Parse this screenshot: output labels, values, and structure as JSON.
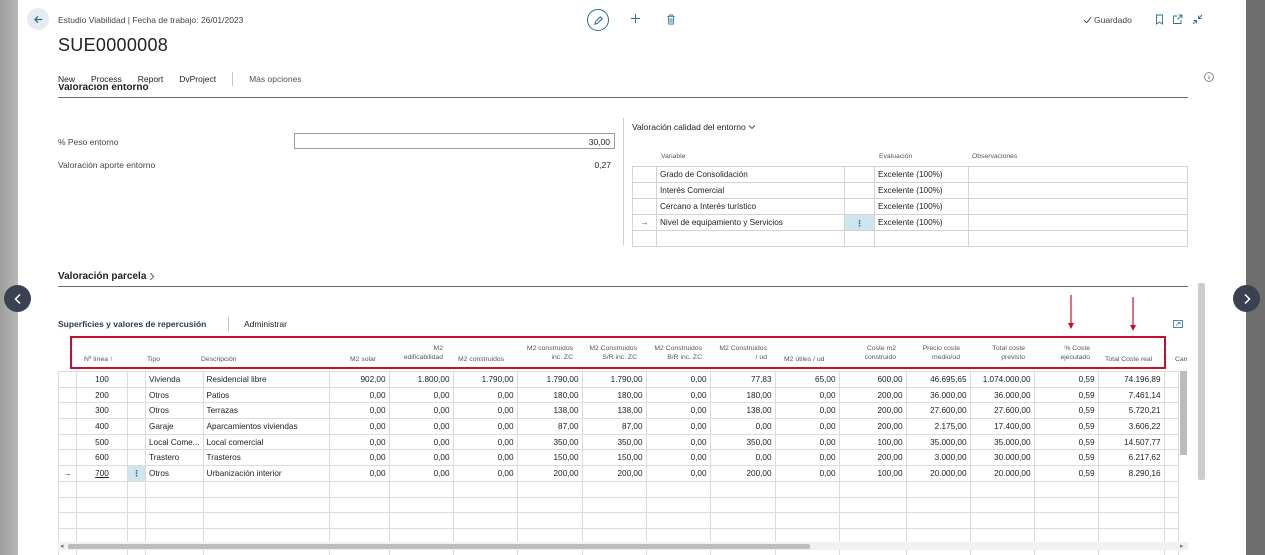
{
  "header": {
    "breadcrumb": "Estudio Viabilidad | Fecha de trabajo: 26/01/2023",
    "record_no": "SUE0000008",
    "saved_label": "Guardado"
  },
  "actions": {
    "new": "New",
    "process": "Process",
    "report": "Report",
    "dvproject": "DvProject",
    "more": "Más opciones"
  },
  "entorno": {
    "section_title": "Valoración entorno",
    "peso_label": "% Peso entorno",
    "peso_value": "30,00",
    "aporte_label": "Valoración aporte entorno",
    "aporte_value": "0,27",
    "calidad_title": "Valoración calidad del entorno",
    "columns": {
      "variable": "Variable",
      "evaluacion": "Evaluación",
      "observaciones": "Observaciones"
    },
    "rows": [
      {
        "variable": "Grado de Consolidación",
        "evaluacion": "Excelente (100%)",
        "observaciones": ""
      },
      {
        "variable": "Interés Comercial",
        "evaluacion": "Excelente (100%)",
        "observaciones": ""
      },
      {
        "variable": "Cercano a Interés turístico",
        "evaluacion": "Excelente (100%)",
        "observaciones": ""
      },
      {
        "variable": "Nivel de equipamiento y Servicios",
        "evaluacion": "Excelente (100%)",
        "observaciones": ""
      }
    ],
    "current_row_marker": "→",
    "dots": "⋮"
  },
  "parcela": {
    "section_title": "Valoración parcela"
  },
  "superficies": {
    "title": "Superficies y valores de repercusión",
    "admin": "Administrar",
    "columns": {
      "linea": "Nº línea ↑",
      "tipo": "Tipo",
      "descripcion": "Descripción",
      "m2_solar": "M2 solar",
      "m2_edif_1": "M2",
      "m2_edif_2": "edificabilidad",
      "m2_const": "M2 construidos",
      "m2_zc_1": "M2 construidos",
      "m2_zc_2": "inc. ZC",
      "m2_sr_1": "M2 Construidos",
      "m2_sr_2": "S/R inc. ZC",
      "m2_br_1": "M2 Construidos",
      "m2_br_2": "B/R inc. ZC",
      "m2_ud_1": "M2 Construidos",
      "m2_ud_2": "/ ud",
      "m2_utiles": "M2 útiles / ud",
      "coste_m2_1": "Coste m2",
      "coste_m2_2": "construido",
      "precio_1": "Precio coste",
      "precio_2": "medio/ud",
      "total_prev_1": "Total coste",
      "total_prev_2": "previsto",
      "pct_1": "% Coste",
      "pct_2": "ejecutado",
      "total_real": "Total Coste real",
      "cut": "Can"
    },
    "rows": [
      {
        "linea": "100",
        "tipo": "Vivienda",
        "desc": "Residencial libre",
        "solar": "902,00",
        "edif": "1.800,00",
        "const": "1.790,00",
        "zc": "1.790,00",
        "sr": "1.790,00",
        "br": "0,00",
        "ud": "77,83",
        "utiles": "65,00",
        "coste": "600,00",
        "precio": "46.695,65",
        "prev": "1.074.000,00",
        "pct": "0,59",
        "real": "74.196,89"
      },
      {
        "linea": "200",
        "tipo": "Otros",
        "desc": "Patios",
        "solar": "0,00",
        "edif": "0,00",
        "const": "0,00",
        "zc": "180,00",
        "sr": "180,00",
        "br": "0,00",
        "ud": "180,00",
        "utiles": "0,00",
        "coste": "200,00",
        "precio": "36.000,00",
        "prev": "36.000,00",
        "pct": "0,59",
        "real": "7.461,14"
      },
      {
        "linea": "300",
        "tipo": "Otros",
        "desc": "Terrazas",
        "solar": "0,00",
        "edif": "0,00",
        "const": "0,00",
        "zc": "138,00",
        "sr": "138,00",
        "br": "0,00",
        "ud": "138,00",
        "utiles": "0,00",
        "coste": "200,00",
        "precio": "27.600,00",
        "prev": "27.600,00",
        "pct": "0,59",
        "real": "5.720,21"
      },
      {
        "linea": "400",
        "tipo": "Garaje",
        "desc": "Aparcamientos viviendas",
        "solar": "0,00",
        "edif": "0,00",
        "const": "0,00",
        "zc": "87,00",
        "sr": "87,00",
        "br": "0,00",
        "ud": "0,00",
        "utiles": "0,00",
        "coste": "200,00",
        "precio": "2.175,00",
        "prev": "17.400,00",
        "pct": "0,59",
        "real": "3.606,22"
      },
      {
        "linea": "500",
        "tipo": "Local Come...",
        "desc": "Local comercial",
        "solar": "0,00",
        "edif": "0,00",
        "const": "0,00",
        "zc": "350,00",
        "sr": "350,00",
        "br": "0,00",
        "ud": "350,00",
        "utiles": "0,00",
        "coste": "100,00",
        "precio": "35.000,00",
        "prev": "35.000,00",
        "pct": "0,59",
        "real": "14.507,77"
      },
      {
        "linea": "600",
        "tipo": "Trastero",
        "desc": "Trasteros",
        "solar": "0,00",
        "edif": "0,00",
        "const": "0,00",
        "zc": "150,00",
        "sr": "150,00",
        "br": "0,00",
        "ud": "0,00",
        "utiles": "0,00",
        "coste": "200,00",
        "precio": "3.000,00",
        "prev": "30.000,00",
        "pct": "0,59",
        "real": "6.217,62"
      },
      {
        "linea": "700",
        "tipo": "Otros",
        "desc": "Urbanización interior",
        "solar": "0,00",
        "edif": "0,00",
        "const": "0,00",
        "zc": "200,00",
        "sr": "200,00",
        "br": "0,00",
        "ud": "200,00",
        "utiles": "0,00",
        "coste": "100,00",
        "precio": "20.000,00",
        "prev": "20.000,00",
        "pct": "0,59",
        "real": "8.290,16"
      }
    ]
  },
  "colors": {
    "accent": "#2a6f8f",
    "highlight_box": "#c8102e",
    "selected_cell": "#cfe6ef",
    "nav_button": "#3a4150"
  }
}
